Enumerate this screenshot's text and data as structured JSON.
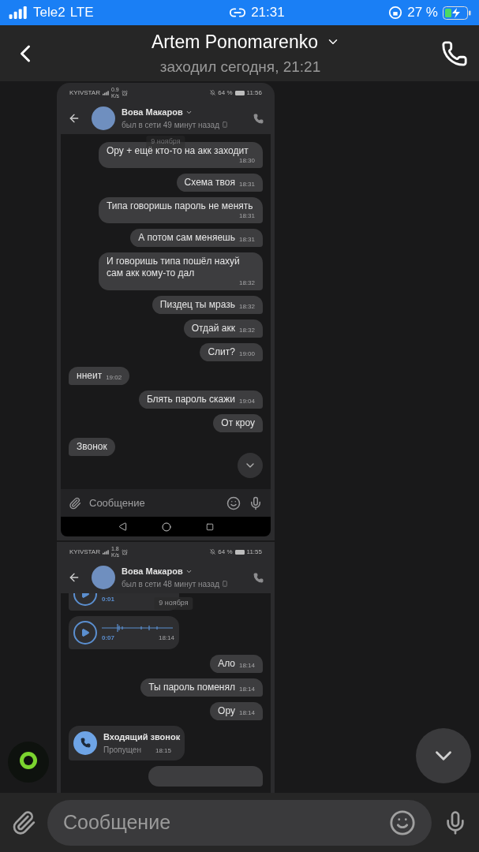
{
  "status_bar": {
    "carrier": "Tele2",
    "network": "LTE",
    "time": "21:31",
    "battery": "27 %"
  },
  "header": {
    "title": "Artem Ponomarenko",
    "subtitle": "заходил сегодня, 21:21"
  },
  "screenshots": [
    {
      "status": {
        "carrier": "KYIVSTAR",
        "speed_value": "0.9",
        "speed_unit": "K/s",
        "battery": "64 %",
        "time": "11:56"
      },
      "contact": {
        "name": "Вова Макаров",
        "presence": "был в сети 49 минут назад"
      },
      "date_chip": "9 ноября",
      "messages": [
        {
          "kind": "text",
          "outgoing": true,
          "text": "Ору + ещё кто-то на акк заходит",
          "time": "18:30"
        },
        {
          "kind": "text",
          "outgoing": true,
          "text": "Схема твоя",
          "time": "18:31"
        },
        {
          "kind": "text",
          "outgoing": true,
          "text": "Типа говоришь пароль не менять",
          "time": "18:31"
        },
        {
          "kind": "text",
          "outgoing": true,
          "text": "А потом сам меняешь",
          "time": "18:31"
        },
        {
          "kind": "text",
          "outgoing": true,
          "text": "И говоришь типа пошёл нахуй сам акк кому-то дал",
          "time": "18:32"
        },
        {
          "kind": "text",
          "outgoing": true,
          "text": "Пиздец ты мразь",
          "time": "18:32"
        },
        {
          "kind": "text",
          "outgoing": true,
          "text": "Отдай акк",
          "time": "18:32"
        },
        {
          "kind": "text",
          "outgoing": true,
          "text": "Слит?",
          "time": "19:00"
        },
        {
          "kind": "text",
          "outgoing": false,
          "text": "ннеит",
          "time": "19:02"
        },
        {
          "kind": "text",
          "outgoing": true,
          "text": "Блять пароль скажи",
          "time": "19:04"
        },
        {
          "kind": "text",
          "outgoing": true,
          "text": "От кроу"
        },
        {
          "kind": "text",
          "outgoing": false,
          "text": "Звонок"
        }
      ],
      "composer": {
        "placeholder": "Сообщение"
      }
    },
    {
      "status": {
        "carrier": "KYIVSTAR",
        "speed_value": "1.8",
        "speed_unit": "K/s",
        "battery": "64 %",
        "time": "11:55"
      },
      "contact": {
        "name": "Вова Макаров",
        "presence": "был в сети 48 минут назад"
      },
      "date_chip": "9 ноября",
      "messages": [
        {
          "kind": "voice",
          "outgoing": false,
          "duration": "0:01"
        },
        {
          "kind": "voice",
          "outgoing": false,
          "duration": "0:07",
          "time": "18:14"
        },
        {
          "kind": "text",
          "outgoing": true,
          "text": "Ало",
          "time": "18:14"
        },
        {
          "kind": "text",
          "outgoing": true,
          "text": "Ты пароль поменял",
          "time": "18:14"
        },
        {
          "kind": "text",
          "outgoing": true,
          "text": "Ору",
          "time": "18:14"
        },
        {
          "kind": "call",
          "outgoing": false,
          "title": "Входящий звонок",
          "status": "Пропущен",
          "time": "18:15"
        },
        {
          "kind": "clipped",
          "outgoing": true
        }
      ]
    }
  ],
  "composer": {
    "placeholder": "Сообщение"
  }
}
